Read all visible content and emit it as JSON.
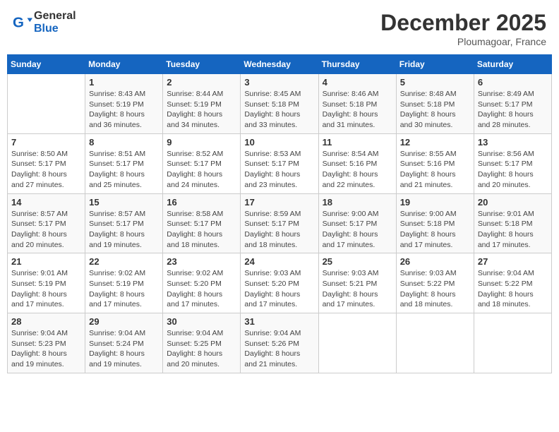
{
  "header": {
    "logo_line1": "General",
    "logo_line2": "Blue",
    "month": "December 2025",
    "location": "Ploumagoar, France"
  },
  "weekdays": [
    "Sunday",
    "Monday",
    "Tuesday",
    "Wednesday",
    "Thursday",
    "Friday",
    "Saturday"
  ],
  "weeks": [
    [
      {
        "day": "",
        "info": ""
      },
      {
        "day": "1",
        "info": "Sunrise: 8:43 AM\nSunset: 5:19 PM\nDaylight: 8 hours\nand 36 minutes."
      },
      {
        "day": "2",
        "info": "Sunrise: 8:44 AM\nSunset: 5:19 PM\nDaylight: 8 hours\nand 34 minutes."
      },
      {
        "day": "3",
        "info": "Sunrise: 8:45 AM\nSunset: 5:18 PM\nDaylight: 8 hours\nand 33 minutes."
      },
      {
        "day": "4",
        "info": "Sunrise: 8:46 AM\nSunset: 5:18 PM\nDaylight: 8 hours\nand 31 minutes."
      },
      {
        "day": "5",
        "info": "Sunrise: 8:48 AM\nSunset: 5:18 PM\nDaylight: 8 hours\nand 30 minutes."
      },
      {
        "day": "6",
        "info": "Sunrise: 8:49 AM\nSunset: 5:17 PM\nDaylight: 8 hours\nand 28 minutes."
      }
    ],
    [
      {
        "day": "7",
        "info": "Sunrise: 8:50 AM\nSunset: 5:17 PM\nDaylight: 8 hours\nand 27 minutes."
      },
      {
        "day": "8",
        "info": "Sunrise: 8:51 AM\nSunset: 5:17 PM\nDaylight: 8 hours\nand 25 minutes."
      },
      {
        "day": "9",
        "info": "Sunrise: 8:52 AM\nSunset: 5:17 PM\nDaylight: 8 hours\nand 24 minutes."
      },
      {
        "day": "10",
        "info": "Sunrise: 8:53 AM\nSunset: 5:17 PM\nDaylight: 8 hours\nand 23 minutes."
      },
      {
        "day": "11",
        "info": "Sunrise: 8:54 AM\nSunset: 5:16 PM\nDaylight: 8 hours\nand 22 minutes."
      },
      {
        "day": "12",
        "info": "Sunrise: 8:55 AM\nSunset: 5:16 PM\nDaylight: 8 hours\nand 21 minutes."
      },
      {
        "day": "13",
        "info": "Sunrise: 8:56 AM\nSunset: 5:17 PM\nDaylight: 8 hours\nand 20 minutes."
      }
    ],
    [
      {
        "day": "14",
        "info": "Sunrise: 8:57 AM\nSunset: 5:17 PM\nDaylight: 8 hours\nand 20 minutes."
      },
      {
        "day": "15",
        "info": "Sunrise: 8:57 AM\nSunset: 5:17 PM\nDaylight: 8 hours\nand 19 minutes."
      },
      {
        "day": "16",
        "info": "Sunrise: 8:58 AM\nSunset: 5:17 PM\nDaylight: 8 hours\nand 18 minutes."
      },
      {
        "day": "17",
        "info": "Sunrise: 8:59 AM\nSunset: 5:17 PM\nDaylight: 8 hours\nand 18 minutes."
      },
      {
        "day": "18",
        "info": "Sunrise: 9:00 AM\nSunset: 5:17 PM\nDaylight: 8 hours\nand 17 minutes."
      },
      {
        "day": "19",
        "info": "Sunrise: 9:00 AM\nSunset: 5:18 PM\nDaylight: 8 hours\nand 17 minutes."
      },
      {
        "day": "20",
        "info": "Sunrise: 9:01 AM\nSunset: 5:18 PM\nDaylight: 8 hours\nand 17 minutes."
      }
    ],
    [
      {
        "day": "21",
        "info": "Sunrise: 9:01 AM\nSunset: 5:19 PM\nDaylight: 8 hours\nand 17 minutes."
      },
      {
        "day": "22",
        "info": "Sunrise: 9:02 AM\nSunset: 5:19 PM\nDaylight: 8 hours\nand 17 minutes."
      },
      {
        "day": "23",
        "info": "Sunrise: 9:02 AM\nSunset: 5:20 PM\nDaylight: 8 hours\nand 17 minutes."
      },
      {
        "day": "24",
        "info": "Sunrise: 9:03 AM\nSunset: 5:20 PM\nDaylight: 8 hours\nand 17 minutes."
      },
      {
        "day": "25",
        "info": "Sunrise: 9:03 AM\nSunset: 5:21 PM\nDaylight: 8 hours\nand 17 minutes."
      },
      {
        "day": "26",
        "info": "Sunrise: 9:03 AM\nSunset: 5:22 PM\nDaylight: 8 hours\nand 18 minutes."
      },
      {
        "day": "27",
        "info": "Sunrise: 9:04 AM\nSunset: 5:22 PM\nDaylight: 8 hours\nand 18 minutes."
      }
    ],
    [
      {
        "day": "28",
        "info": "Sunrise: 9:04 AM\nSunset: 5:23 PM\nDaylight: 8 hours\nand 19 minutes."
      },
      {
        "day": "29",
        "info": "Sunrise: 9:04 AM\nSunset: 5:24 PM\nDaylight: 8 hours\nand 19 minutes."
      },
      {
        "day": "30",
        "info": "Sunrise: 9:04 AM\nSunset: 5:25 PM\nDaylight: 8 hours\nand 20 minutes."
      },
      {
        "day": "31",
        "info": "Sunrise: 9:04 AM\nSunset: 5:26 PM\nDaylight: 8 hours\nand 21 minutes."
      },
      {
        "day": "",
        "info": ""
      },
      {
        "day": "",
        "info": ""
      },
      {
        "day": "",
        "info": ""
      }
    ]
  ]
}
